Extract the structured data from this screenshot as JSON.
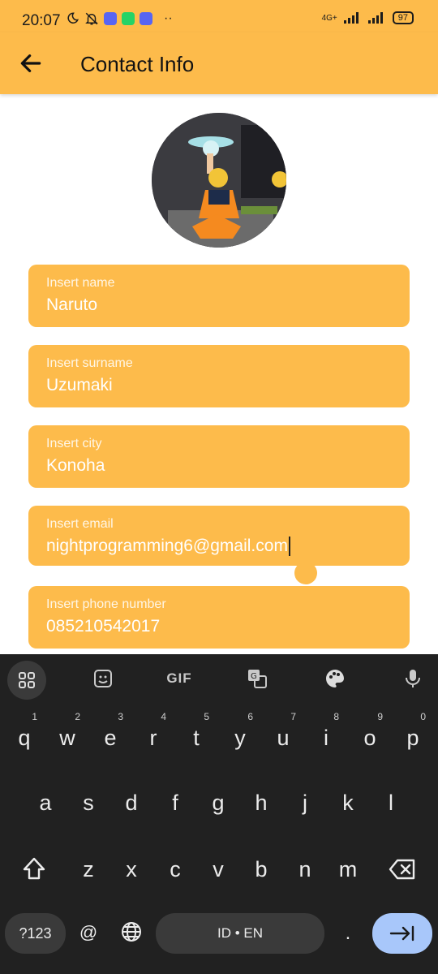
{
  "status_bar": {
    "time": "20:07",
    "network": "4G+",
    "battery": "97"
  },
  "app_bar": {
    "title": "Contact Info"
  },
  "form": {
    "fields": [
      {
        "label": "Insert name",
        "value": "Naruto"
      },
      {
        "label": "Insert surname",
        "value": "Uzumaki"
      },
      {
        "label": "Insert city",
        "value": "Konoha"
      },
      {
        "label": "Insert email",
        "value": "nightprogramming6@gmail.com"
      },
      {
        "label": "Insert phone number",
        "value": "085210542017"
      }
    ]
  },
  "keyboard": {
    "toolbar": {
      "gif_label": "GIF"
    },
    "row1": [
      {
        "key": "q",
        "hint": "1"
      },
      {
        "key": "w",
        "hint": "2"
      },
      {
        "key": "e",
        "hint": "3"
      },
      {
        "key": "r",
        "hint": "4"
      },
      {
        "key": "t",
        "hint": "5"
      },
      {
        "key": "y",
        "hint": "6"
      },
      {
        "key": "u",
        "hint": "7"
      },
      {
        "key": "i",
        "hint": "8"
      },
      {
        "key": "o",
        "hint": "9"
      },
      {
        "key": "p",
        "hint": "0"
      }
    ],
    "row2": [
      "a",
      "s",
      "d",
      "f",
      "g",
      "h",
      "j",
      "k",
      "l"
    ],
    "row3": [
      "z",
      "x",
      "c",
      "v",
      "b",
      "n",
      "m"
    ],
    "symbols_label": "?123",
    "at_label": "@",
    "space_label": "ID • EN",
    "period_label": "."
  },
  "colors": {
    "accent": "#fdbb4b",
    "keyboard_bg": "#212121",
    "enter_key": "#a8c7fa"
  }
}
